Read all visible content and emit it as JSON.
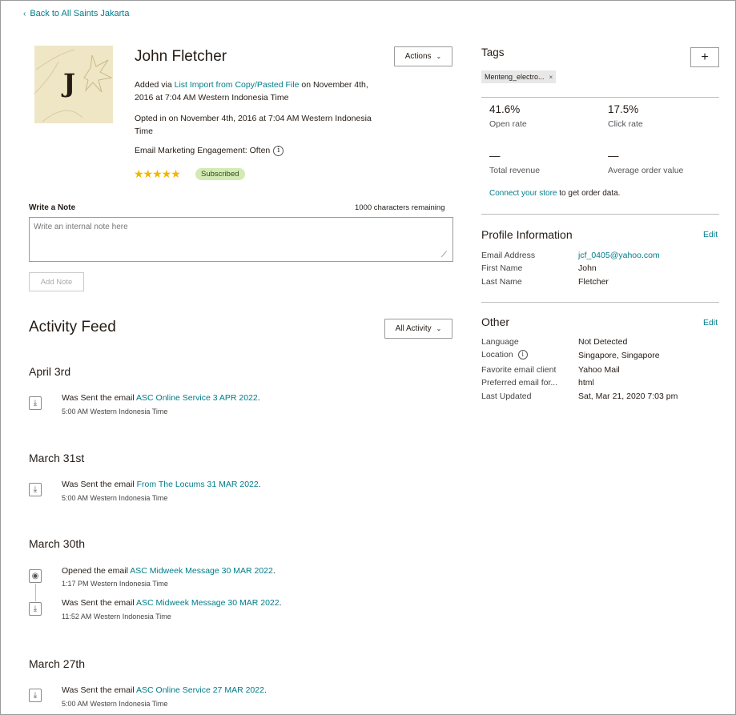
{
  "nav": {
    "back_label": "Back to All Saints Jakarta"
  },
  "profile": {
    "initial": "J",
    "name": "John Fletcher",
    "actions_label": "Actions",
    "added_prefix": "Added via ",
    "added_link": "List Import from Copy/Pasted File",
    "added_suffix": " on November 4th, 2016 at 7:04 AM Western Indonesia Time",
    "opted_in": "Opted in on November 4th, 2016 at 7:04 AM Western Indonesia Time",
    "engagement": "Email Marketing Engagement: Often",
    "info_glyph": "i",
    "stars": "★★★★★",
    "rating": 5,
    "status_badge": "Subscribed"
  },
  "note": {
    "label": "Write a Note",
    "remaining": "1000 characters remaining",
    "placeholder": "Write an internal note here",
    "add_label": "Add Note"
  },
  "feed": {
    "title": "Activity Feed",
    "filter_label": "All Activity",
    "groups": [
      {
        "date": "April 3rd",
        "items": [
          {
            "icon": "download-icon",
            "verb": "Was Sent",
            "mid": " the email ",
            "link": "ASC Online Service 3 APR 2022",
            "end": ".",
            "time": "5:00 AM Western Indonesia Time"
          }
        ]
      },
      {
        "date": "March 31st",
        "items": [
          {
            "icon": "download-icon",
            "verb": "Was Sent",
            "mid": " the email ",
            "link": "From The Locums 31 MAR 2022",
            "end": ".",
            "time": "5:00 AM Western Indonesia Time"
          }
        ]
      },
      {
        "date": "March 30th",
        "items": [
          {
            "icon": "eye-icon",
            "verb": "Opened",
            "mid": " the email ",
            "link": "ASC Midweek Message 30 MAR 2022",
            "end": ".",
            "time": "1:17 PM Western Indonesia Time"
          },
          {
            "icon": "download-icon",
            "verb": "Was Sent",
            "mid": " the email ",
            "link": "ASC Midweek Message 30 MAR 2022",
            "end": ".",
            "time": "11:52 AM Western Indonesia Time"
          }
        ]
      },
      {
        "date": "March 27th",
        "items": [
          {
            "icon": "download-icon",
            "verb": "Was Sent",
            "mid": " the email ",
            "link": "ASC Online Service 27 MAR 2022",
            "end": ".",
            "time": "5:00 AM Western Indonesia Time"
          }
        ]
      }
    ]
  },
  "tags": {
    "title": "Tags",
    "add_glyph": "+",
    "items": [
      {
        "label": "Menteng_electro...",
        "remove_glyph": "×"
      }
    ]
  },
  "stats": {
    "open_rate": {
      "value": "41.6%",
      "label": "Open rate"
    },
    "click_rate": {
      "value": "17.5%",
      "label": "Click rate"
    },
    "total_revenue": {
      "value": "—",
      "label": "Total revenue"
    },
    "avg_order": {
      "value": "—",
      "label": "Average order value"
    },
    "connect_link": "Connect your store",
    "connect_suffix": " to get order data."
  },
  "profile_info": {
    "title": "Profile Information",
    "edit_label": "Edit",
    "rows": [
      {
        "key": "Email Address",
        "value": "jcf_0405@yahoo.com",
        "link": true
      },
      {
        "key": "First Name",
        "value": "John",
        "link": false
      },
      {
        "key": "Last Name",
        "value": "Fletcher",
        "link": false
      }
    ]
  },
  "other": {
    "title": "Other",
    "edit_label": "Edit",
    "rows": [
      {
        "key": "Language",
        "value": "Not Detected"
      },
      {
        "key": "Location",
        "value": "Singapore, Singapore",
        "info": true
      },
      {
        "key": "Favorite email client",
        "value": "Yahoo Mail"
      },
      {
        "key": "Preferred email for...",
        "value": "html"
      },
      {
        "key": "Last Updated",
        "value": "Sat, Mar 21, 2020 7:03 pm"
      }
    ]
  },
  "colors": {
    "link": "#007c89",
    "star": "#f2b600",
    "badge_bg": "#d3eab4",
    "avatar_bg": "#efe6c5"
  }
}
